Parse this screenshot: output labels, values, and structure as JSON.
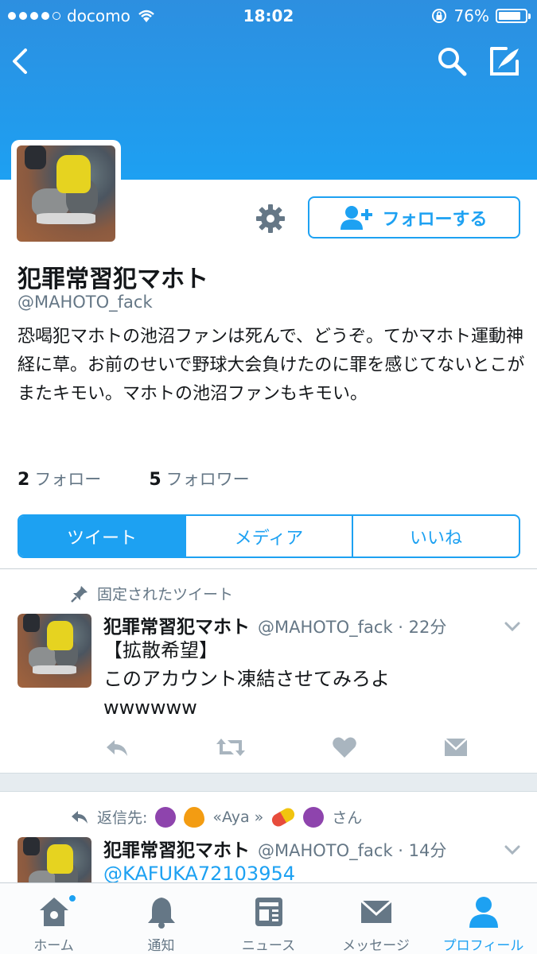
{
  "status": {
    "carrier": "docomo",
    "time": "18:02",
    "battery": "76%",
    "battery_level": 0.76
  },
  "nav": {
    "icons": [
      "back-chevron-icon",
      "search-icon",
      "compose-icon"
    ]
  },
  "profile": {
    "name": "犯罪常習犯マホト",
    "handle": "@MAHOTO_fack",
    "follow_label": "フォローする",
    "bio": "恐喝犯マホトの池沼ファンは死んで、どうぞ。てかマホト運動神経に草。お前のせいで野球大会負けたのに罪を感じてないとこがまたキモい。マホトの池沼ファンもキモい。",
    "following_count": "2",
    "following_label": "フォロー",
    "followers_count": "5",
    "followers_label": "フォロワー"
  },
  "tabs": [
    {
      "label": "ツイート",
      "active": true
    },
    {
      "label": "メディア",
      "active": false
    },
    {
      "label": "いいね",
      "active": false
    }
  ],
  "tweets": [
    {
      "context": "固定されたツイート",
      "name": "犯罪常習犯マホト",
      "meta": "@MAHOTO_fack · 22分",
      "lines": [
        "【拡散希望】",
        "このアカウント凍結させてみろよ",
        "wwwwww"
      ]
    },
    {
      "context_prefix": "返信先:",
      "context_text": "«Aya »",
      "context_suffix": "さん",
      "name": "犯罪常習犯マホト",
      "meta": "@MAHOTO_fack · 14分",
      "mention": "@KAFUKA72103954"
    }
  ],
  "bottom_tabs": [
    {
      "label": "ホーム",
      "icon": "home-icon",
      "active": false
    },
    {
      "label": "通知",
      "icon": "bell-icon",
      "active": false
    },
    {
      "label": "ニュース",
      "icon": "news-icon",
      "active": false
    },
    {
      "label": "メッセージ",
      "icon": "envelope-icon",
      "active": false
    },
    {
      "label": "プロフィール",
      "icon": "person-icon",
      "active": true
    }
  ],
  "colors": {
    "accent": "#1da1f2",
    "header": "#1da1f2",
    "muted": "#657786"
  }
}
